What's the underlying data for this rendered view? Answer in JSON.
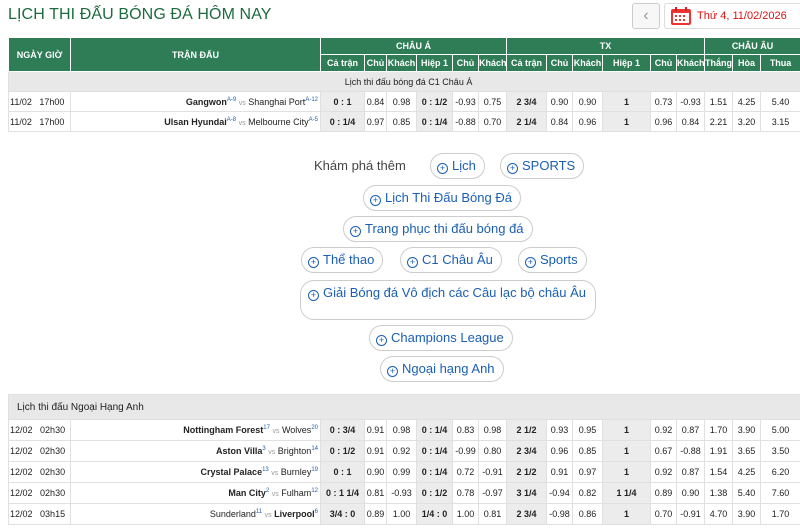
{
  "header": {
    "title": "LỊCH THI ĐẤU BÓNG ĐÁ HÔM NAY",
    "prev_label": "‹",
    "date": "Thứ 4, 11/02/2026"
  },
  "table_headers": {
    "time": "NGÀY GIỜ",
    "match": "TRẬN ĐẤU",
    "asia": "CHÂU Á",
    "tx": "TX",
    "euro": "CHÂU ÂU",
    "sub": [
      "Cả trận",
      "Chủ",
      "Khách",
      "Hiệp 1",
      "Chủ",
      "Khách",
      "Cả trận",
      "Chủ",
      "Khách",
      "Hiệp 1",
      "Chủ",
      "Khách",
      "Thắng",
      "Hòa",
      "Thua"
    ]
  },
  "league1": {
    "name": "Lịch thi đấu bóng đá C1 Châu Á",
    "matches": [
      {
        "date": "11/02",
        "time": "17h00",
        "home": "Gangwon",
        "home_rank": "A-9",
        "away": "Shanghai Port",
        "away_rank": "A-12",
        "hcap": "0 : 1",
        "h_home": "0.84",
        "h_away": "0.98",
        "hcap1": "0 : 1/2",
        "h1_home": "-0.93",
        "h1_away": "0.75",
        "ou": "2 3/4",
        "o": "0.90",
        "u": "0.90",
        "ou1": "1",
        "o1": "0.73",
        "u1": "-0.93",
        "w": "1.51",
        "d": "4.25",
        "l": "5.40"
      },
      {
        "date": "11/02",
        "time": "17h00",
        "home": "Ulsan Hyundai",
        "home_rank": "A-8",
        "away": "Melbourne City",
        "away_rank": "A-5",
        "hcap": "0 : 1/4",
        "h_home": "0.97",
        "h_away": "0.85",
        "hcap1": "0 : 1/4",
        "h1_home": "-0.88",
        "h1_away": "0.70",
        "ou": "2 1/4",
        "o": "0.84",
        "u": "0.96",
        "ou1": "1",
        "o1": "0.96",
        "u1": "0.84",
        "w": "2.21",
        "d": "3.20",
        "l": "3.15"
      }
    ]
  },
  "explore": {
    "label": "Khám phá thêm",
    "chips": [
      "Lịch",
      "SPORTS",
      "Lịch Thi Đấu Bóng Đá",
      "Trang phục thi đấu bóng đá",
      "Thể thao",
      "C1 Châu Âu",
      "Sports",
      "Giải Bóng đá Vô địch các Câu lạc bộ châu Âu",
      "Champions League",
      "Ngoại hạng Anh"
    ]
  },
  "league2": {
    "name": "Lịch thi đấu Ngoại Hạng Anh",
    "matches": [
      {
        "date": "12/02",
        "time": "02h30",
        "home": "Nottingham Forest",
        "home_rank": "17",
        "away": "Wolves",
        "away_rank": "20",
        "home_bold": true,
        "hcap": "0 : 3/4",
        "h_home": "0.91",
        "h_away": "0.98",
        "hcap1": "0 : 1/4",
        "h1_home": "0.83",
        "h1_away": "0.98",
        "ou": "2 1/2",
        "o": "0.93",
        "u": "0.95",
        "ou1": "1",
        "o1": "0.92",
        "u1": "0.87",
        "w": "1.70",
        "d": "3.90",
        "l": "5.00"
      },
      {
        "date": "12/02",
        "time": "02h30",
        "home": "Aston Villa",
        "home_rank": "3",
        "away": "Brighton",
        "away_rank": "14",
        "home_bold": true,
        "hcap": "0 : 1/2",
        "h_home": "0.91",
        "h_away": "0.92",
        "hcap1": "0 : 1/4",
        "h1_home": "-0.99",
        "h1_away": "0.80",
        "ou": "2 3/4",
        "o": "0.96",
        "u": "0.85",
        "ou1": "1",
        "o1": "0.67",
        "u1": "-0.88",
        "w": "1.91",
        "d": "3.65",
        "l": "3.50"
      },
      {
        "date": "12/02",
        "time": "02h30",
        "home": "Crystal Palace",
        "home_rank": "13",
        "away": "Burnley",
        "away_rank": "19",
        "home_bold": true,
        "hcap": "0 : 1",
        "h_home": "0.90",
        "h_away": "0.99",
        "hcap1": "0 : 1/4",
        "h1_home": "0.72",
        "h1_away": "-0.91",
        "ou": "2 1/2",
        "o": "0.91",
        "u": "0.97",
        "ou1": "1",
        "o1": "0.92",
        "u1": "0.87",
        "w": "1.54",
        "d": "4.25",
        "l": "6.20"
      },
      {
        "date": "12/02",
        "time": "02h30",
        "home": "Man City",
        "home_rank": "2",
        "away": "Fulham",
        "away_rank": "12",
        "home_bold": true,
        "hcap": "0 : 1 1/4",
        "h_home": "0.81",
        "h_away": "-0.93",
        "hcap1": "0 : 1/2",
        "h1_home": "0.78",
        "h1_away": "-0.97",
        "ou": "3 1/4",
        "o": "-0.94",
        "u": "0.82",
        "ou1": "1 1/4",
        "o1": "0.89",
        "u1": "0.90",
        "w": "1.38",
        "d": "5.40",
        "l": "7.60"
      },
      {
        "date": "12/02",
        "time": "03h15",
        "home": "Sunderland",
        "home_rank": "11",
        "away": "Liverpool",
        "away_rank": "6",
        "home_bold": false,
        "hcap": "3/4 : 0",
        "h_home": "0.89",
        "h_away": "1.00",
        "hcap1": "1/4 : 0",
        "h1_home": "1.00",
        "h1_away": "0.81",
        "ou": "2 3/4",
        "o": "-0.98",
        "u": "0.86",
        "ou1": "1",
        "o1": "0.70",
        "u1": "-0.91",
        "w": "4.70",
        "d": "3.90",
        "l": "1.70"
      }
    ]
  },
  "colors": {
    "header_green": "#2e7d57",
    "title_green": "#1d6b3f",
    "link_blue": "#1a5fb4",
    "date_red": "#dd1111"
  }
}
